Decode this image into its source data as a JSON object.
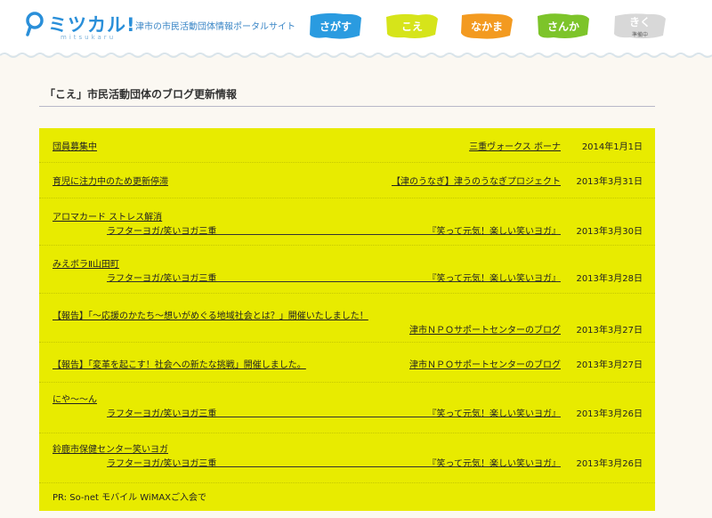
{
  "header": {
    "logo_text": "ミツカル!",
    "logo_sub": "mitsukaru",
    "tagline": "津市の市民活動団体情報ポータルサイト",
    "nav": [
      {
        "label": "さがす",
        "color": "#2a9be0",
        "sub": ""
      },
      {
        "label": "こえ",
        "color": "#d6e41a",
        "sub": ""
      },
      {
        "label": "なかま",
        "color": "#f39a20",
        "sub": ""
      },
      {
        "label": "さんか",
        "color": "#7dc42a",
        "sub": ""
      },
      {
        "label": "きく",
        "color": "#d8d8d8",
        "sub": "準備中"
      }
    ]
  },
  "section": {
    "title": "「こえ」市民活動団体のブログ更新情報"
  },
  "colors": {
    "panel": "#e8eb00",
    "brand_blue": "#2a8fd9"
  },
  "posts": [
    {
      "title": "団員募集中",
      "author": "三重ヴォークス ボーナ",
      "date": "2014年1月1日"
    },
    {
      "title": "育児に注力中のため更新停滞",
      "author": "【津のうなぎ】津うのうなぎプロジェクト",
      "date": "2013年3月31日"
    },
    {
      "title": "アロマカード ストレス解消",
      "group": "ラフターヨガ/笑いヨガ三重",
      "author": "『笑って元気！楽しい笑いヨガ』",
      "date": "2013年3月30日"
    },
    {
      "title": "みえボラⅡ山田町",
      "group": "ラフターヨガ/笑いヨガ三重",
      "author": "『笑って元気！楽しい笑いヨガ』",
      "date": "2013年3月28日"
    },
    {
      "title": "【報告】「～応援のかたち～想いがめぐる地域社会とは？」開催いたしました！",
      "author": "津市ＮＰＯサポートセンターのブログ",
      "date": "2013年3月27日"
    },
    {
      "title": "【報告】「変革を起こす！社会への新たな挑戦」開催しました。",
      "author": "津市ＮＰＯサポートセンターのブログ",
      "date": "2013年3月27日"
    },
    {
      "title": "にや～～ん",
      "group": "ラフターヨガ/笑いヨガ三重",
      "author": "『笑って元気！楽しい笑いヨガ』",
      "date": "2013年3月26日"
    },
    {
      "title": "鈴鹿市保健センター笑いヨガ",
      "group": "ラフターヨガ/笑いヨガ三重",
      "author": "『笑って元気！楽しい笑いヨガ』",
      "date": "2013年3月26日"
    },
    {
      "title": "PR: So-net モバイル WiMAXご入会で"
    }
  ]
}
